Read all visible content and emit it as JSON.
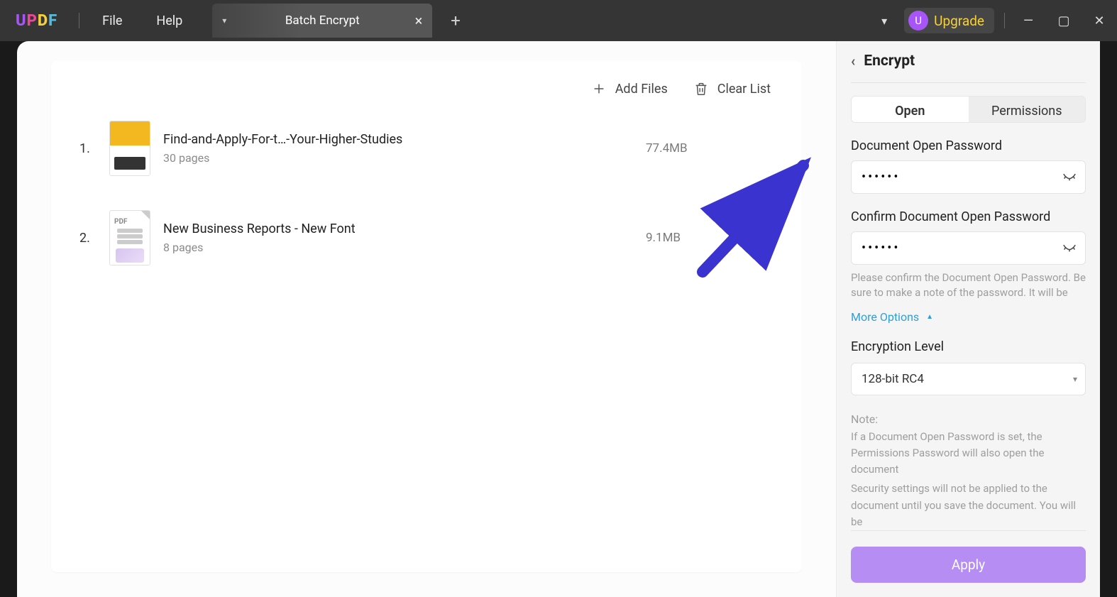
{
  "titlebar": {
    "menus": {
      "file": "File",
      "help": "Help"
    },
    "tab_title": "Batch Encrypt",
    "upgrade": "Upgrade",
    "avatar_letter": "U"
  },
  "toolbar": {
    "add_files": "Add Files",
    "clear_list": "Clear List"
  },
  "files": [
    {
      "num": "1.",
      "title": "Find-and-Apply-For-t…-Your-Higher-Studies",
      "pages": "30 pages",
      "size": "77.4MB"
    },
    {
      "num": "2.",
      "title": "New Business Reports - New Font",
      "pages": "8 pages",
      "size": "9.1MB"
    }
  ],
  "side": {
    "title": "Encrypt",
    "tab_open": "Open",
    "tab_permissions": "Permissions",
    "pwd_label": "Document Open Password",
    "pwd_value": "••••••",
    "pwd2_label": "Confirm Document Open Password",
    "pwd2_value": "••••••",
    "hint": "Please confirm the Document Open Password. Be sure to make a note of the password. It will be",
    "more": "More Options",
    "enc_label": "Encryption Level",
    "enc_value": "128-bit RC4",
    "note_head": "Note:",
    "note1": "If a Document Open Password is set, the Permissions Password will also open the document",
    "note2": "Security settings will not be applied to the document until you save the document. You will be",
    "apply": "Apply"
  }
}
